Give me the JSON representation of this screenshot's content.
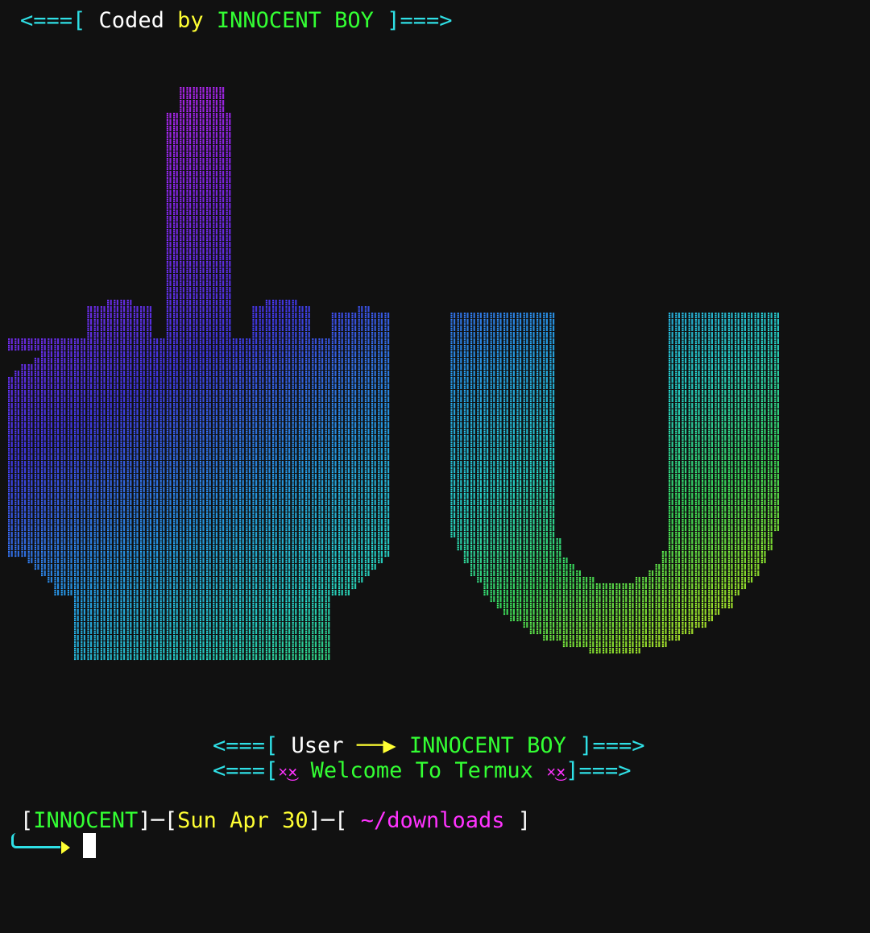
{
  "header": {
    "open": "<===[ ",
    "coded": "Coded ",
    "by": "by ",
    "author": "INNOCENT BOY",
    "close": " ]===>"
  },
  "banner": {
    "user_prefix": "<===[ ",
    "user_label": "User ",
    "user_arrow": "──▶ ",
    "user_name": "INNOCENT BOY",
    "user_suffix": " ]===>",
    "welcome_prefix": "<===[",
    "welcome_face_left": "×͜×",
    "welcome_text": " Welcome To Termux ",
    "welcome_face_right": "×͜×",
    "welcome_suffix": "]===>"
  },
  "prompt": {
    "bracket_open": "[",
    "user": "INNOCENT",
    "sep1": "]─[",
    "date": "Sun Apr 30",
    "sep2": "]─[ ",
    "path": "~/downloads",
    "bracket_close": " ]"
  },
  "colors": {
    "background": "#111111",
    "cyan": "#2fe0e6",
    "yellow": "#ffff33",
    "green": "#33ff33",
    "magenta": "#ff33ff",
    "white": "#ffffff"
  },
  "art": {
    "description": "dotted ascii art of a raised middle finger and letter U, gradient magenta to blue to cyan to green to yellow"
  }
}
